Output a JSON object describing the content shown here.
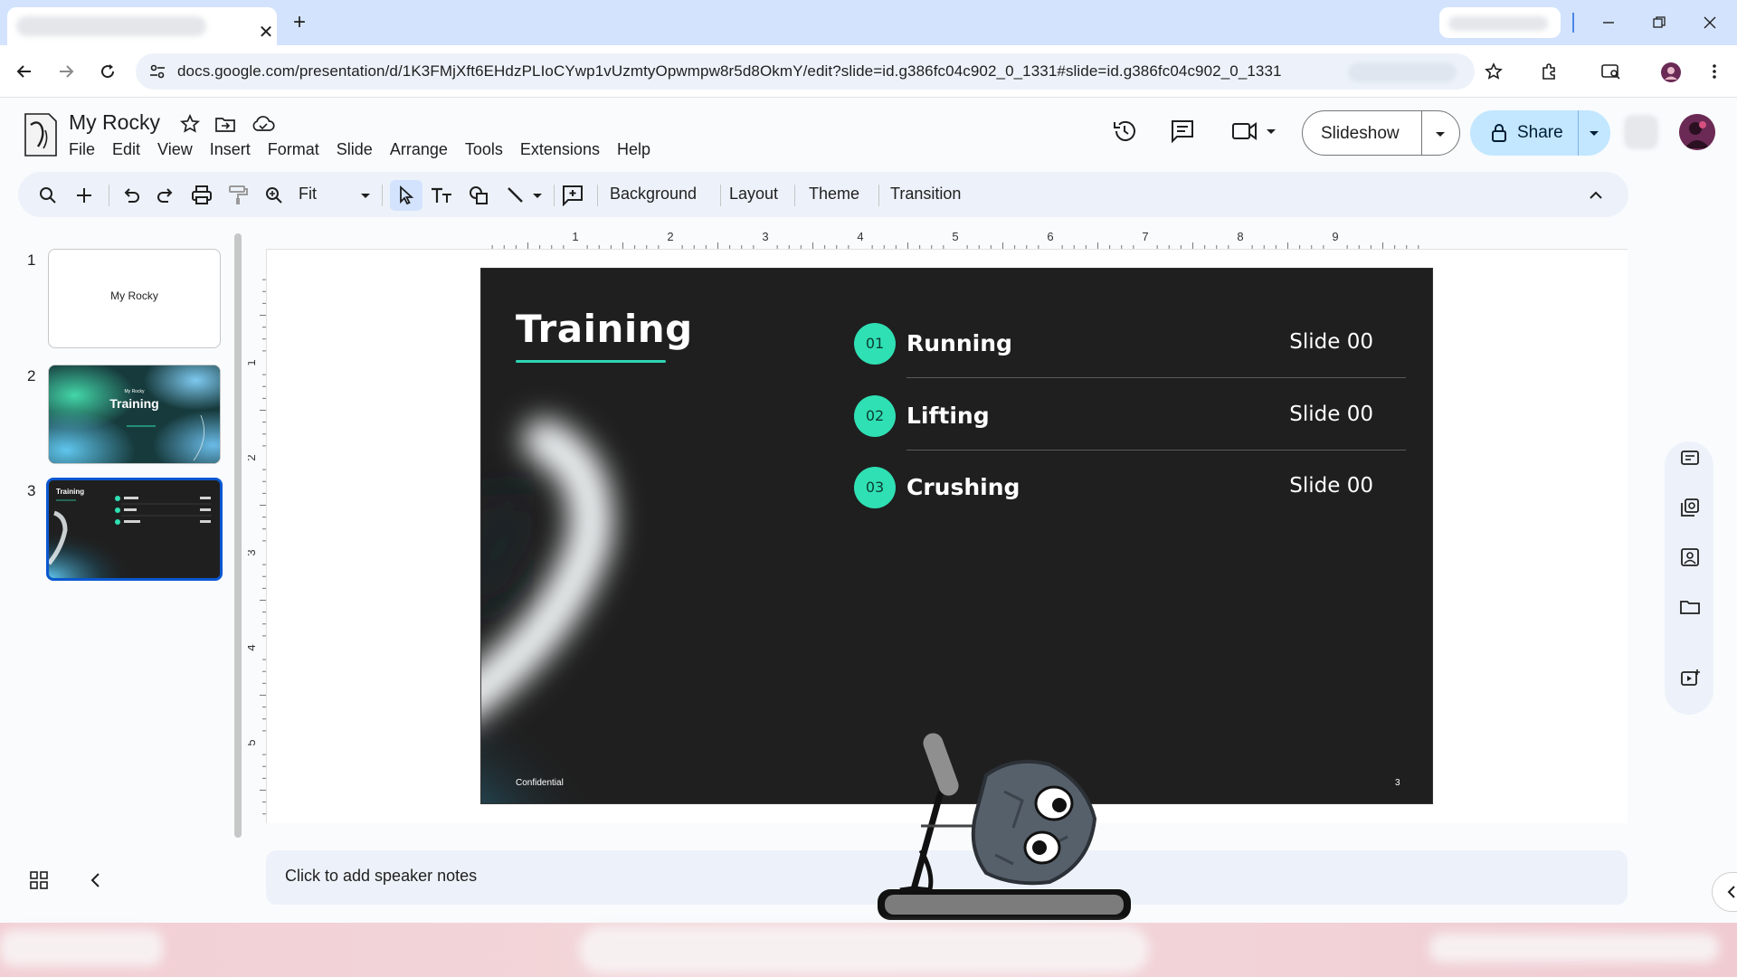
{
  "browser": {
    "tab_close": "✕",
    "new_tab": "+",
    "url": "docs.google.com/presentation/d/1K3FMjXft6EHdzPLIoCYwp1vUzmtyOpwmpw8r5d8OkmY/edit?slide=id.g386fc04c902_0_1331#slide=id.g386fc04c902_0_1331"
  },
  "doc": {
    "title": "My Rocky",
    "menu": [
      "File",
      "Edit",
      "View",
      "Insert",
      "Format",
      "Slide",
      "Arrange",
      "Tools",
      "Extensions",
      "Help"
    ],
    "slideshow_label": "Slideshow",
    "share_label": "Share"
  },
  "toolbar": {
    "zoom": "Fit",
    "background": "Background",
    "layout": "Layout",
    "theme": "Theme",
    "transition": "Transition"
  },
  "ruler": {
    "h_numbers": [
      "1",
      "2",
      "3",
      "4",
      "5",
      "6",
      "7",
      "8",
      "9"
    ],
    "v_numbers": [
      "1",
      "2",
      "3",
      "4",
      "5"
    ]
  },
  "filmstrip": [
    {
      "num": "1",
      "title": "My Rocky"
    },
    {
      "num": "2",
      "subtitle": "My Rocky",
      "title": "Training"
    },
    {
      "num": "3",
      "title": "Training",
      "selected": true
    }
  ],
  "slide": {
    "title": "Training",
    "items": [
      {
        "num": "01",
        "label": "Running",
        "ref": "Slide 00"
      },
      {
        "num": "02",
        "label": "Lifting",
        "ref": "Slide 00"
      },
      {
        "num": "03",
        "label": "Crushing",
        "ref": "Slide 00"
      }
    ],
    "footer": "Confidential",
    "page_number": "3",
    "accent_color": "#2fe0b4"
  },
  "notes": {
    "placeholder": "Click to add speaker notes"
  }
}
